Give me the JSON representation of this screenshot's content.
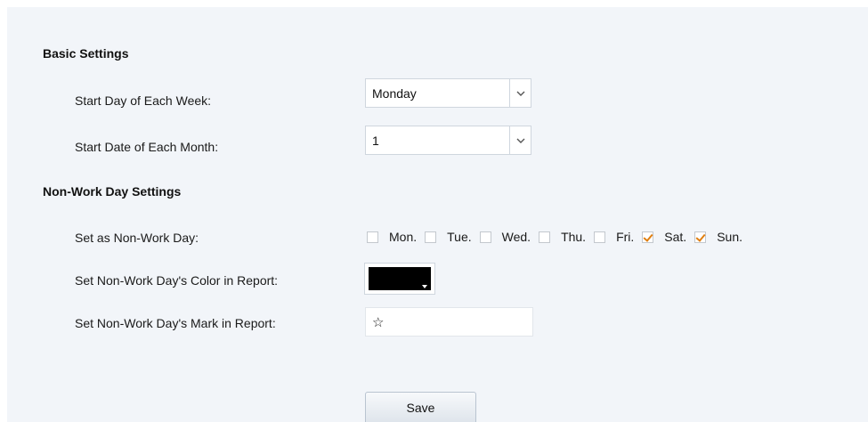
{
  "basic_settings": {
    "title": "Basic Settings",
    "start_day_label": "Start Day of Each Week:",
    "start_day_value": "Monday",
    "start_date_label": "Start Date of Each Month:",
    "start_date_value": "1"
  },
  "non_work_settings": {
    "title": "Non-Work Day Settings",
    "set_non_work_label": "Set as Non-Work Day:",
    "days": [
      {
        "label": "Mon.",
        "checked": false
      },
      {
        "label": "Tue.",
        "checked": false
      },
      {
        "label": "Wed.",
        "checked": false
      },
      {
        "label": "Thu.",
        "checked": false
      },
      {
        "label": "Fri.",
        "checked": false
      },
      {
        "label": "Sat.",
        "checked": true
      },
      {
        "label": "Sun.",
        "checked": true
      }
    ],
    "color_label": "Set Non-Work Day's Color in Report:",
    "color_value": "#000000",
    "mark_label": "Set Non-Work Day's Mark in Report:",
    "mark_value": "☆"
  },
  "actions": {
    "save_label": "Save"
  },
  "colors": {
    "panel_bg": "#f2f5f9",
    "checkbox_accent": "#e07f10"
  }
}
